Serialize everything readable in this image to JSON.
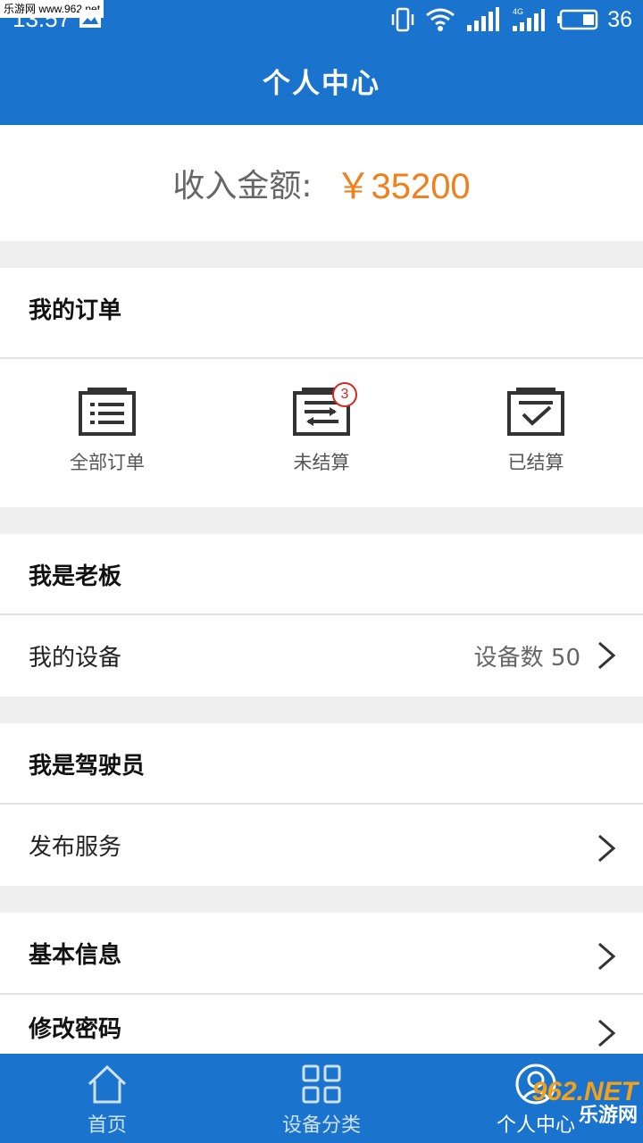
{
  "status_bar": {
    "time": "13:57",
    "network_badge": "4G",
    "battery": "36",
    "watermark": "乐游网 www.962.net"
  },
  "header": {
    "title": "个人中心"
  },
  "income": {
    "label": "收入金额:",
    "value": "￥35200"
  },
  "orders": {
    "title": "我的订单",
    "items": [
      {
        "label": "全部订单",
        "icon": "all-orders-icon"
      },
      {
        "label": "未结算",
        "icon": "unsettled-icon",
        "badge": "3"
      },
      {
        "label": "已结算",
        "icon": "settled-icon"
      }
    ]
  },
  "boss": {
    "title": "我是老板",
    "device_label": "我的设备",
    "device_value": "设备数 50"
  },
  "driver": {
    "title": "我是驾驶员",
    "publish_label": "发布服务"
  },
  "account": {
    "basic_info": "基本信息",
    "change_password": "修改密码"
  },
  "bottom_nav": {
    "items": [
      {
        "label": "首页",
        "icon": "home-icon"
      },
      {
        "label": "设备分类",
        "icon": "grid-icon"
      },
      {
        "label": "个人中心",
        "icon": "user-icon"
      }
    ],
    "watermark_num": "962.NET",
    "watermark_text": "乐游网"
  },
  "colors": {
    "primary": "#1a73cc",
    "accent": "#f07f1c",
    "badge": "#d8261f"
  }
}
